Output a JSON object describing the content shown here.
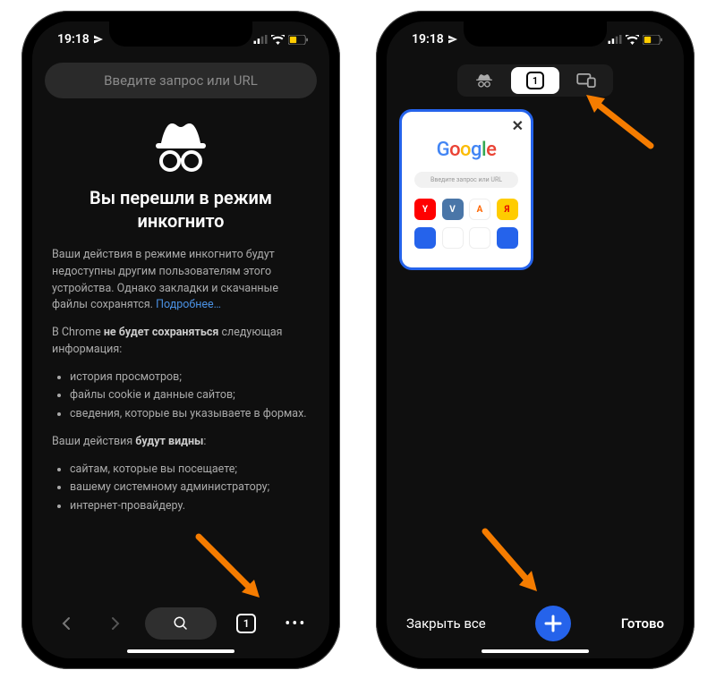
{
  "status": {
    "time": "19:18",
    "battery_color": "#ffcc00"
  },
  "left": {
    "url_placeholder": "Введите запрос или URL",
    "heading": "Вы перешли в режим инкогнито",
    "intro_text": "Ваши действия в режиме инкогнито будут недоступны другим пользователям этого устройства. Однако закладки и скачанные файлы сохранятся.",
    "learn_more": "Подробнее…",
    "not_saved_lead_a": "В Chrome ",
    "not_saved_lead_b": "не будет сохраняться",
    "not_saved_lead_c": " следующая информация:",
    "not_saved_items": [
      "история просмотров;",
      "файлы cookie и данные сайтов;",
      "сведения, которые вы указываете в формах."
    ],
    "visible_lead_a": "Ваши действия ",
    "visible_lead_b": "будут видны",
    "visible_lead_c": ":",
    "visible_items": [
      "сайтам, которые вы посещаете;",
      "вашему системному администратору;",
      "интернет-провайдеру."
    ],
    "tab_count": "1"
  },
  "right": {
    "tab_count": "1",
    "card": {
      "search_placeholder": "Введите запрос или URL",
      "tiles": [
        {
          "label": "Y",
          "bg": "#ff0000"
        },
        {
          "label": "V",
          "bg": "#4a76a8"
        },
        {
          "label": "A",
          "bg": "#ffffff",
          "fg": "#ff6600"
        },
        {
          "label": "Я",
          "bg": "#ffcc00",
          "fg": "#e30000"
        }
      ]
    },
    "close_all": "Закрыть все",
    "done": "Готово"
  },
  "arrow_color": "#f57c00"
}
